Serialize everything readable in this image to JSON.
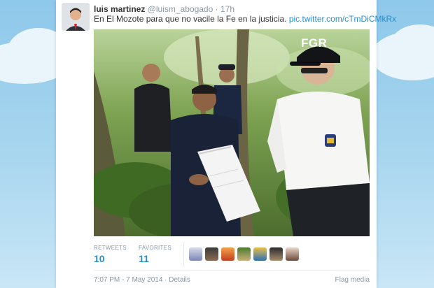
{
  "tweet": {
    "author_name": "luis martinez",
    "author_handle": "@luism_abogado",
    "separator": "·",
    "time_ago": "17h",
    "text": "En El Mozote para que no vacile la Fe en la justicia.",
    "link": "pic.twitter.com/cTmDiCMkRx"
  },
  "photo": {
    "cap_text": "FGR"
  },
  "stats": {
    "retweets_label": "RETWEETS",
    "retweets_count": "10",
    "favorites_label": "FAVORITES",
    "favorites_count": "11",
    "faces_count": 7
  },
  "meta": {
    "timestamp": "7:07 PM - 7 May 2014",
    "separator": "·",
    "details_label": "Details",
    "flag_label": "Flag media"
  },
  "colors": {
    "link": "#2a8ec7",
    "muted": "#8899a6",
    "sky": "#a9d6ef"
  }
}
